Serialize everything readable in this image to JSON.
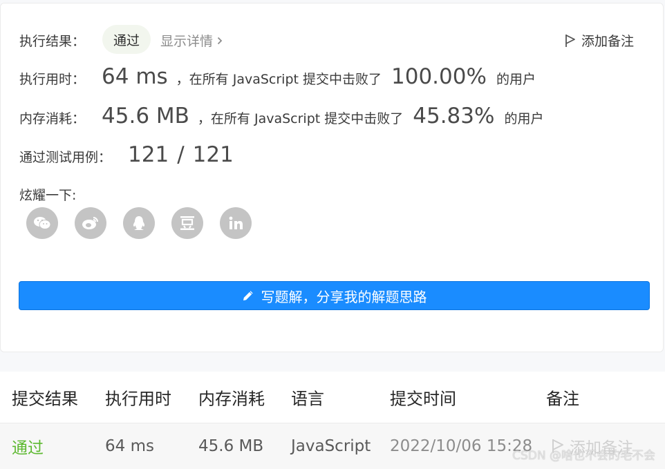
{
  "result": {
    "label": "执行结果：",
    "status": "通过",
    "details_link": "显示详情",
    "add_note": "添加备注"
  },
  "runtime": {
    "label": "执行用时：",
    "value": "64 ms",
    "text_before": "，在所有 JavaScript 提交中击败了",
    "percent": "100.00%",
    "text_after": "的用户"
  },
  "memory": {
    "label": "内存消耗：",
    "value": "45.6 MB",
    "text_before": "，在所有 JavaScript 提交中击败了",
    "percent": "45.83%",
    "text_after": "的用户"
  },
  "testcases": {
    "label": "通过测试用例：",
    "passed": "121",
    "separator": "/",
    "total": "121"
  },
  "share": {
    "label": "炫耀一下:",
    "icons": [
      "wechat-icon",
      "weibo-icon",
      "qq-icon",
      "douban-icon",
      "linkedin-icon"
    ]
  },
  "solution_button": {
    "label": "写题解，分享我的解题思路"
  },
  "table": {
    "headers": [
      "提交结果",
      "执行用时",
      "内存消耗",
      "语言",
      "提交时间",
      "备注"
    ],
    "rows": [
      [
        "通过",
        "64 ms",
        "45.6 MB",
        "JavaScript",
        "2022/10/06 15:28",
        "添加备注"
      ]
    ]
  },
  "watermark": "CSDN @啥也不会的毛不会",
  "colors": {
    "accent": "#1a8cff",
    "pass_green": "#5cb82f",
    "icon_grey": "#c4c4c4"
  }
}
